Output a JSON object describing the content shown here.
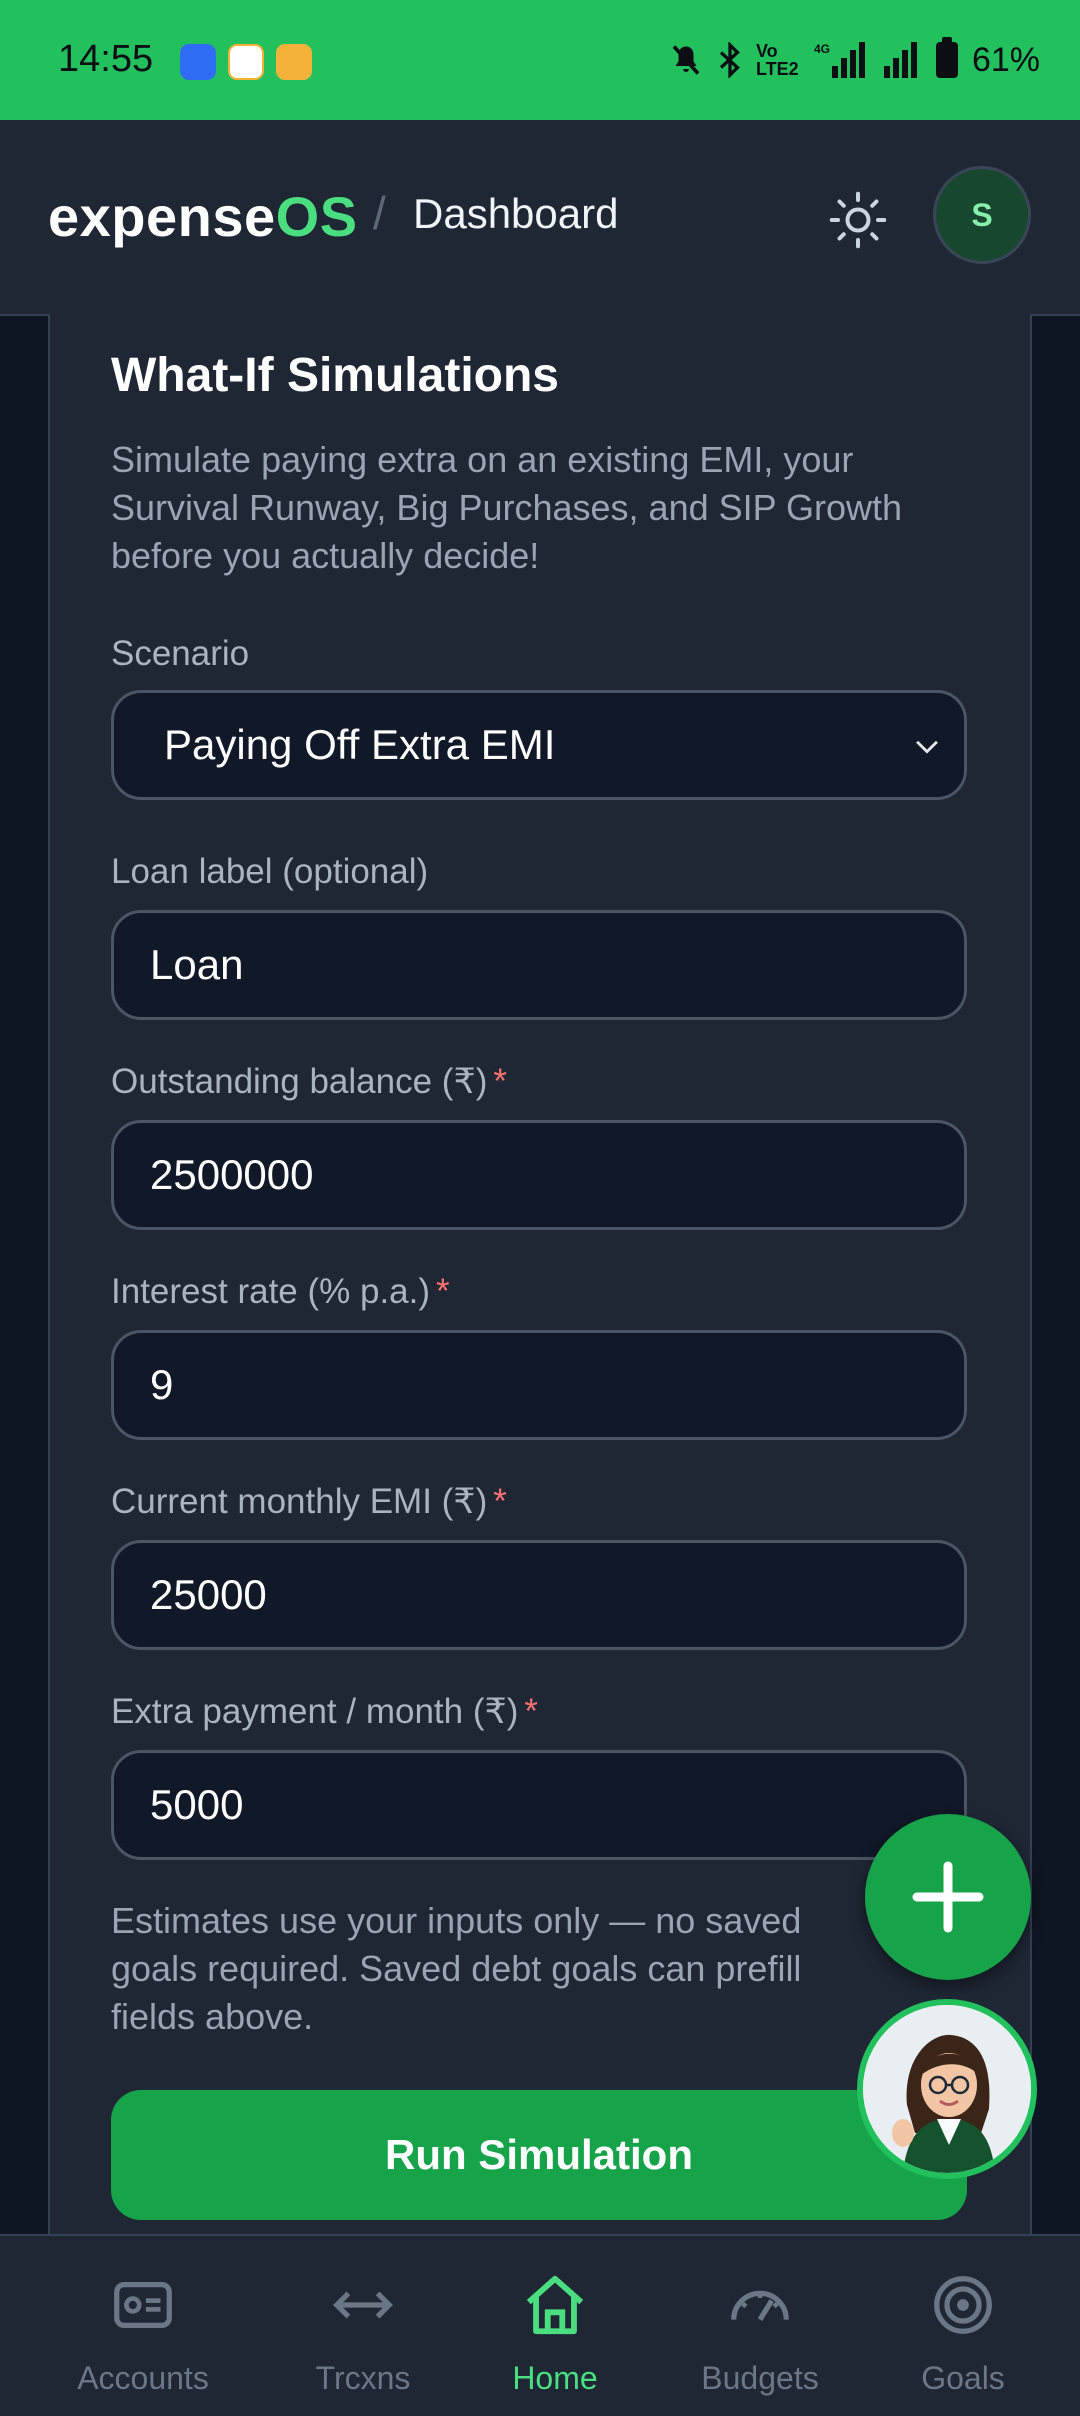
{
  "status_bar": {
    "time": "14:55",
    "battery": "61%",
    "volte_label": "Vo LTE2",
    "network_label": "4G"
  },
  "header": {
    "brand_prefix": "expense",
    "brand_suffix": "OS",
    "separator": "/",
    "page": "Dashboard",
    "avatar_initial": "S"
  },
  "simulation": {
    "title": "What-If Simulations",
    "description": "Simulate paying extra on an existing EMI, your Survival Runway, Big Purchases, and SIP Growth before you actually decide!",
    "scenario_label": "Scenario",
    "scenario_value": "Paying Off Extra EMI",
    "loan_label": "Loan label (optional)",
    "loan_value": "Loan",
    "balance_label": "Outstanding balance (₹)",
    "balance_value": "2500000",
    "rate_label": "Interest rate (% p.a.)",
    "rate_value": "9",
    "emi_label": "Current monthly EMI (₹)",
    "emi_value": "25000",
    "extra_label": "Extra payment / month (₹)",
    "extra_value": "5000",
    "required_mark": "*",
    "note": "Estimates use your inputs only — no saved goals required. Saved debt goals can prefill fields above.",
    "run_button": "Run Simulation"
  },
  "nav": [
    {
      "label": "Accounts",
      "icon": "accounts-icon"
    },
    {
      "label": "Trcxns",
      "icon": "arrows-icon"
    },
    {
      "label": "Home",
      "icon": "home-icon",
      "active": true
    },
    {
      "label": "Budgets",
      "icon": "gauge-icon"
    },
    {
      "label": "Goals",
      "icon": "target-icon"
    }
  ],
  "colors": {
    "accent": "#22c15e",
    "brand_green": "#4ade80",
    "button": "#16a34a",
    "background": "#1f2735",
    "input": "#111827",
    "required": "#f87171"
  }
}
